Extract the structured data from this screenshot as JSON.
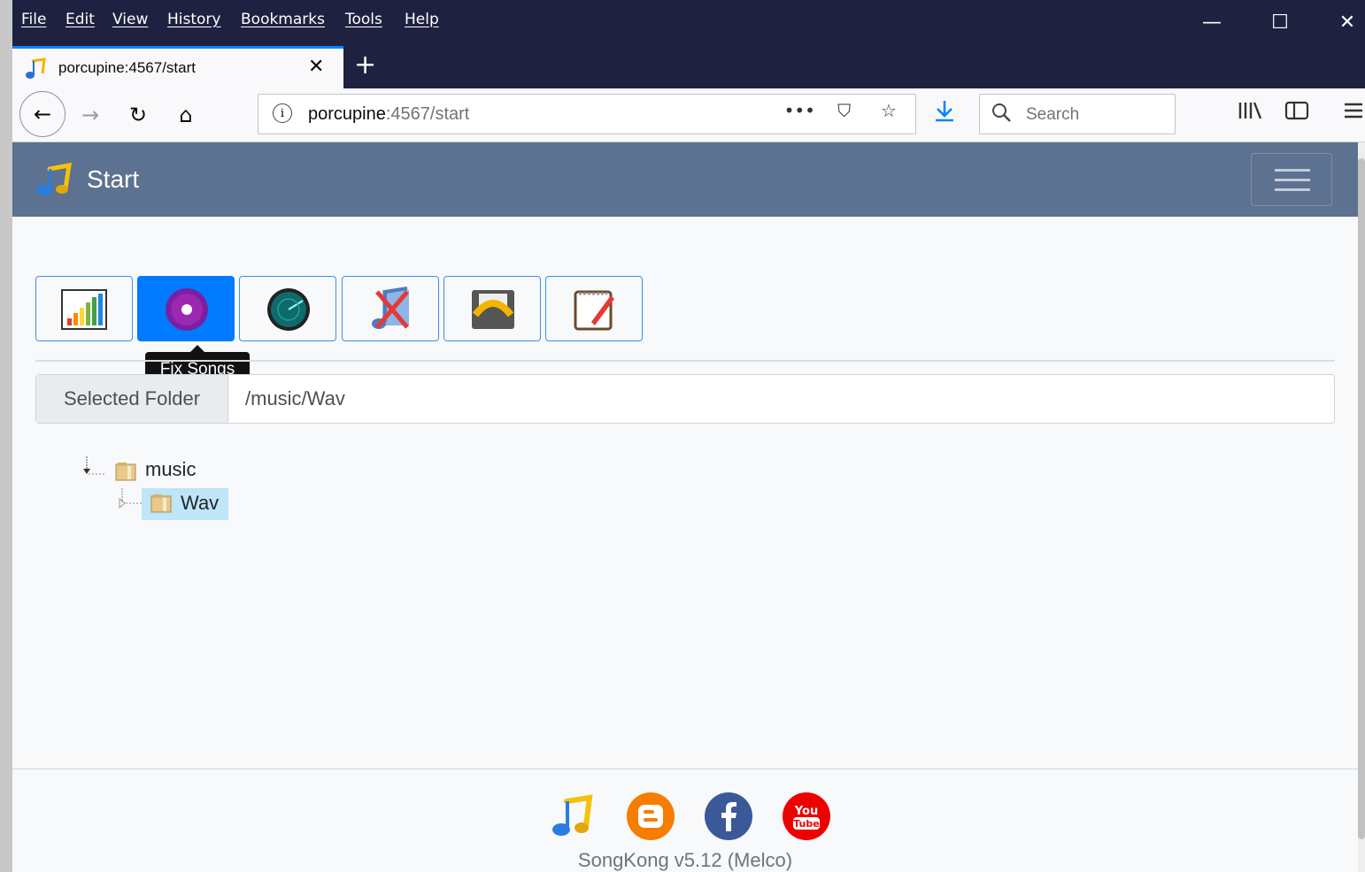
{
  "menu": [
    "File",
    "Edit",
    "View",
    "History",
    "Bookmarks",
    "Tools",
    "Help"
  ],
  "window_controls": {
    "minimize": "—",
    "maximize": "☐",
    "close": "✕"
  },
  "tab": {
    "title": "porcupine:4567/start",
    "close": "✕",
    "new_tab": "+"
  },
  "nav": {
    "back": "←",
    "forward": "→",
    "reload": "↻",
    "home": "⌂"
  },
  "url": {
    "host": "porcupine",
    "rest": ":4567/start",
    "info": "i",
    "more": "•••",
    "pocket": "⛉",
    "bookmark": "☆"
  },
  "search": {
    "placeholder": "Search"
  },
  "app": {
    "title": "Start"
  },
  "task_buttons": [
    {
      "name": "status",
      "icon": "bar-chart-icon",
      "active": false
    },
    {
      "name": "fix-songs",
      "icon": "disc-icon",
      "active": true
    },
    {
      "name": "radar",
      "icon": "radar-icon",
      "active": false
    },
    {
      "name": "delete-duplicates",
      "icon": "music-delete-icon",
      "active": false
    },
    {
      "name": "undo",
      "icon": "undo-icon",
      "active": false
    },
    {
      "name": "notes",
      "icon": "notepad-icon",
      "active": false
    }
  ],
  "tooltip": "Fix Songs",
  "selected_folder": {
    "label": "Selected Folder",
    "value": "/music/Wav"
  },
  "tree": [
    {
      "label": "music",
      "selected": false
    },
    {
      "label": "Wav",
      "selected": true
    }
  ],
  "footer": {
    "version": "SongKong v5.12 (Melco)",
    "social": [
      "songkong-icon",
      "blogger-icon",
      "facebook-icon",
      "youtube-icon"
    ]
  },
  "colors": {
    "header": "#5d7190",
    "active_btn": "#007bff",
    "chrome": "#1f2140"
  }
}
